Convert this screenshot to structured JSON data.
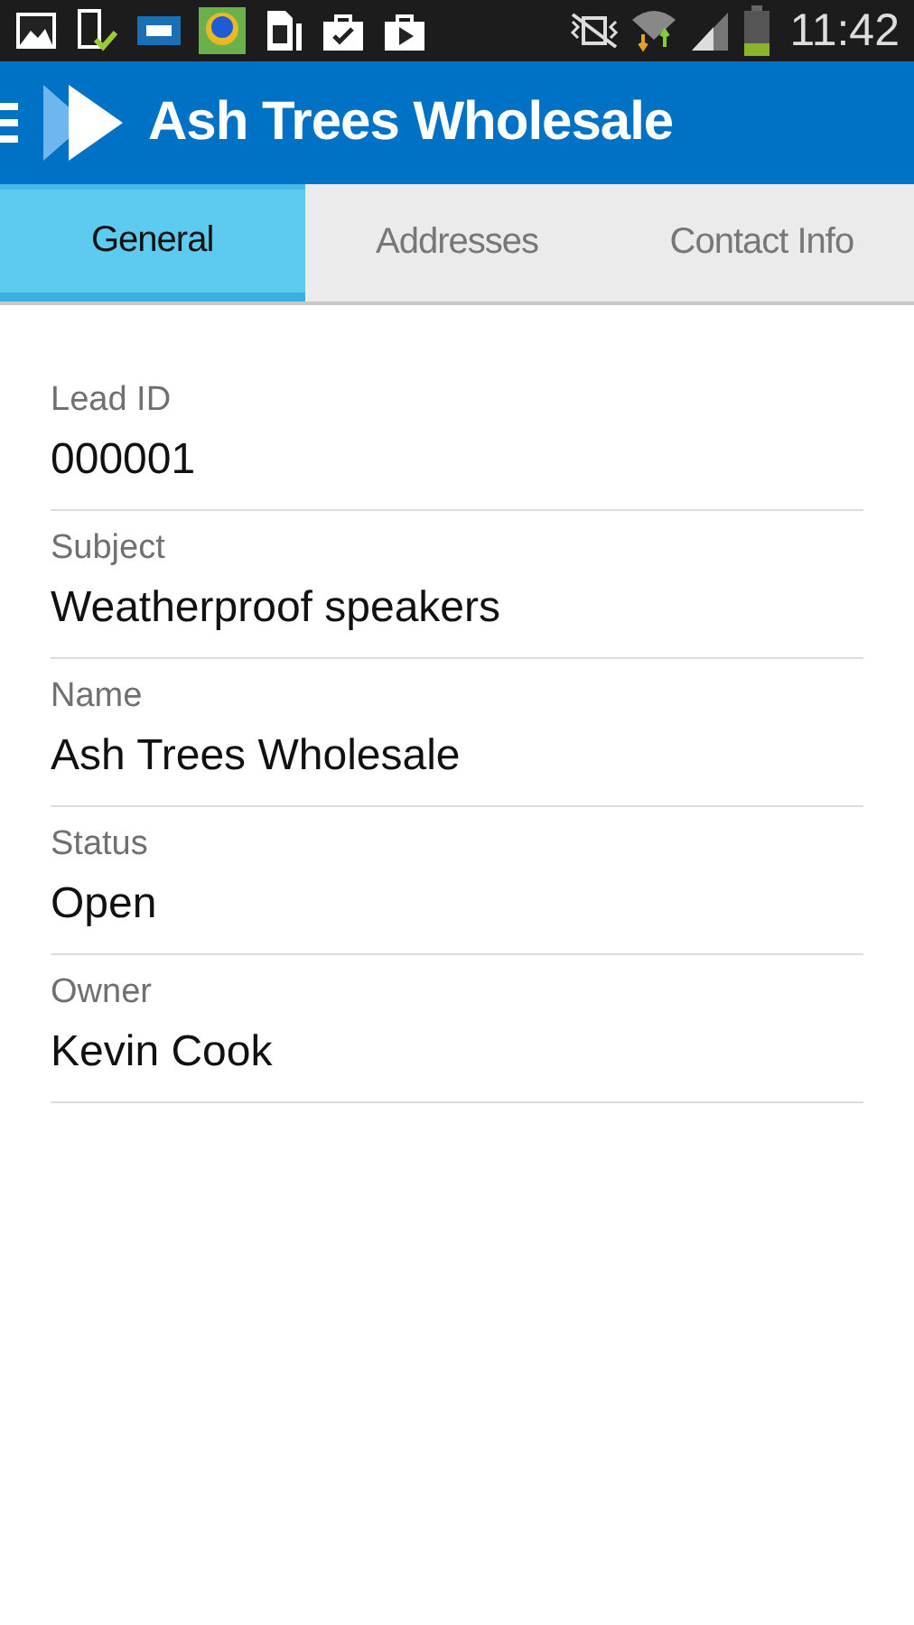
{
  "status_bar": {
    "time": "11:42"
  },
  "app_bar": {
    "title": "Ash Trees Wholesale"
  },
  "tabs": [
    {
      "label": "General",
      "selected": true
    },
    {
      "label": "Addresses",
      "selected": false
    },
    {
      "label": "Contact Info",
      "selected": false
    }
  ],
  "fields": [
    {
      "label": "Lead ID",
      "value": "000001"
    },
    {
      "label": "Subject",
      "value": "Weatherproof speakers"
    },
    {
      "label": "Name",
      "value": "Ash Trees Wholesale"
    },
    {
      "label": "Status",
      "value": "Open"
    },
    {
      "label": "Owner",
      "value": "Kevin Cook"
    }
  ]
}
